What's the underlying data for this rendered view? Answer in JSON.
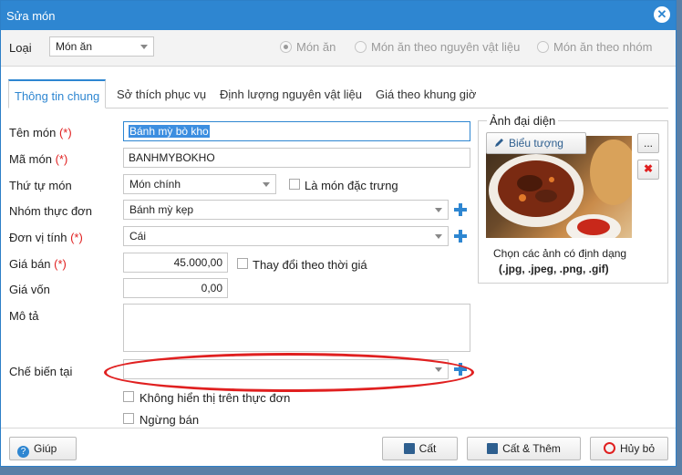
{
  "window": {
    "title": "Sửa món"
  },
  "topbar": {
    "type_label": "Loại",
    "type_value": "Món ăn",
    "radios": [
      {
        "label": "Món ăn",
        "selected": true
      },
      {
        "label": "Món ăn theo nguyên vật liệu",
        "selected": false
      },
      {
        "label": "Món ăn theo nhóm",
        "selected": false
      }
    ]
  },
  "tabs": [
    "Thông tin chung",
    "Sở thích phục vụ",
    "Định lượng nguyên vật liệu",
    "Giá theo khung giờ"
  ],
  "form": {
    "name_label": "Tên món",
    "name_value": "Bánh mỳ bò kho",
    "code_label": "Mã món",
    "code_value": "BANHMYBOKHO",
    "order_label": "Thứ tự món",
    "order_value": "Món chính",
    "specialty_label": "Là món đặc trưng",
    "menu_group_label": "Nhóm thực đơn",
    "menu_group_value": "Bánh mỳ kẹp",
    "unit_label": "Đơn vị tính",
    "unit_value": "Cái",
    "price_label": "Giá bán",
    "price_value": "45.000,00",
    "price_change_label": "Thay đổi theo thời giá",
    "cost_label": "Giá vốn",
    "cost_value": "0,00",
    "desc_label": "Mô tả",
    "desc_value": "",
    "process_label": "Chế biến tại",
    "process_value": "",
    "hide_menu_label": "Không hiển thị trên thực đơn",
    "stop_sale_label": "Ngừng bán",
    "required_mark": "(*)"
  },
  "image_panel": {
    "legend": "Ảnh đại diện",
    "icon_button": "Biểu tượng",
    "more_button": "...",
    "hint_line1": "Chọn các ảnh có định dạng",
    "hint_line2": "(.jpg, .jpeg, .png, .gif)"
  },
  "footer": {
    "help": "Giúp",
    "save": "Cất",
    "save_add": "Cất & Thêm",
    "cancel": "Hủy bỏ"
  },
  "colors": {
    "accent": "#2e86d1",
    "required": "#e02020",
    "highlight": "#e02020"
  }
}
